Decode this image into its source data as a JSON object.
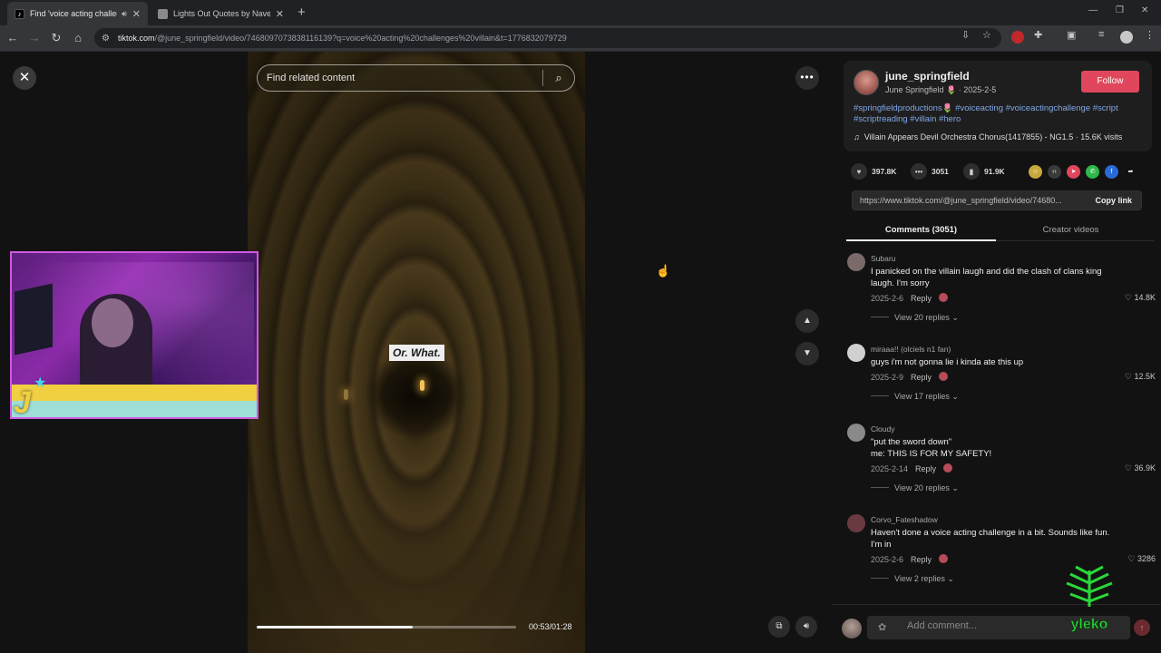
{
  "browser": {
    "tabs": [
      {
        "title": "Find 'voice acting challenge",
        "favicon_color": "#000000",
        "active": true,
        "playing_audio": true
      },
      {
        "title": "Lights Out Quotes by Navessa",
        "favicon_color": "#8a8a8a",
        "active": false,
        "playing_audio": false
      }
    ],
    "new_tab_icon": "plus-icon",
    "url_host": "tiktok.com",
    "url_path": "/@june_springfield/video/7468097073838116139?q=voice%20acting%20challenges%20villain&t=1776832079729"
  },
  "player": {
    "search_placeholder": "Find related content",
    "caption": "Or. What.",
    "progress": 0.6,
    "time": "00:53/01:28"
  },
  "author": {
    "handle": "june_springfield",
    "display_line": "June Springfield 🌷 · 2025-2-5",
    "follow_label": "Follow",
    "description": "#springfieldproductions🌷 #voiceacting #voiceactingchallenge #script #scriptreading #villain #hero",
    "music": "Villain Appears Devil Orchestra Chorus(1417855) - NG1.5 · 15.6K visits"
  },
  "stats": {
    "likes": "397.8K",
    "comments": "3051",
    "saves": "91.9K"
  },
  "share_icons": [
    {
      "name": "friends-share-icon",
      "color": "#c8a83a",
      "glyph": "☺"
    },
    {
      "name": "embed-icon",
      "color": "#3a3a3a",
      "glyph": "‹›"
    },
    {
      "name": "send-to-friends-icon",
      "color": "#e0475c",
      "glyph": "➤"
    },
    {
      "name": "whatsapp-icon",
      "color": "#2eb84a",
      "glyph": "✆"
    },
    {
      "name": "facebook-icon",
      "color": "#2a6ad8",
      "glyph": "f"
    },
    {
      "name": "share-arrow-icon",
      "color": "#121212",
      "glyph": "➦"
    }
  ],
  "link": {
    "url": "https://www.tiktok.com/@june_springfield/video/74680...",
    "copy_label": "Copy link"
  },
  "tabs": {
    "comments": "Comments (3051)",
    "creator_videos": "Creator videos"
  },
  "comments": [
    {
      "author": "Subaru",
      "text": "I panicked on the villain laugh and did the clash of clans king laugh. I'm sorry",
      "date": "2025-2-6",
      "reply": "Reply",
      "likes": "14.8K",
      "view_replies": "View 20 replies ⌄",
      "avatar_color": "#7a6a6a"
    },
    {
      "author": "miraaa!! (olciels n1 fan)",
      "text": "guys i'm not gonna lie i kinda ate this up",
      "date": "2025-2-9",
      "reply": "Reply",
      "likes": "12.5K",
      "view_replies": "View 17 replies ⌄",
      "avatar_color": "#d0d0d0"
    },
    {
      "author": "Cloudy",
      "text": "\"put the sword down\"\nme: THIS IS FOR MY SAFETY!",
      "date": "2025-2-14",
      "reply": "Reply",
      "likes": "36.9K",
      "view_replies": "View 20 replies ⌄",
      "avatar_color": "#8a8a8a"
    },
    {
      "author": "Corvo_Fateshadow",
      "text": "Haven't done a voice acting challenge in a bit. Sounds like fun. I'm in",
      "date": "2025-2-6",
      "reply": "Reply",
      "likes": "3286",
      "view_replies": "View 2 replies ⌄",
      "avatar_color": "#6a3a40"
    }
  ],
  "comment_input_placeholder": "Add comment...",
  "watermark_text": "yleko"
}
